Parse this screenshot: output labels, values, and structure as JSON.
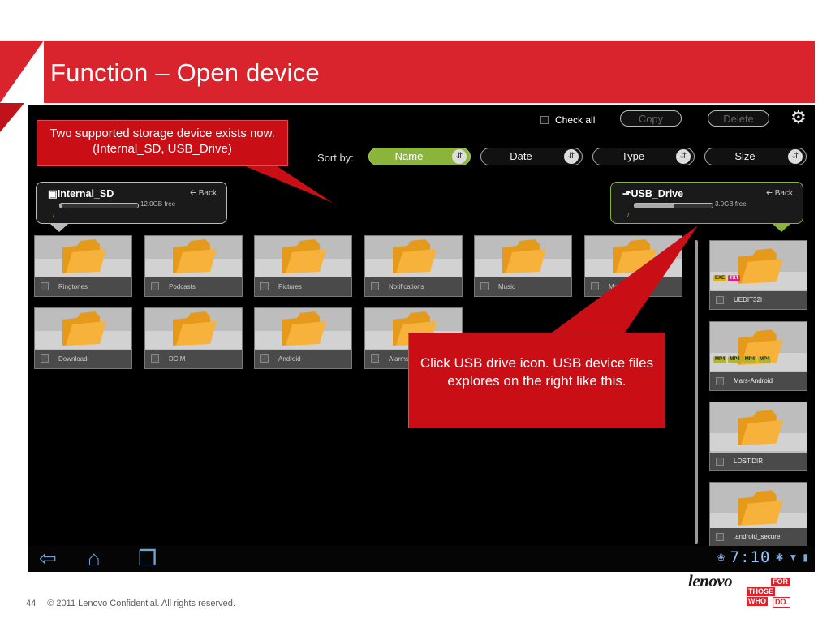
{
  "slide": {
    "title": "Function – Open device",
    "page_number": "44",
    "copyright": "© 2011 Lenovo Confidential. All rights reserved.",
    "logo_text": "lenovo",
    "tagline": [
      "FOR",
      "THOSE",
      "WHO",
      "DO."
    ]
  },
  "callouts": {
    "top_left": "Two supported storage device exists now.(Internal_SD, USB_Drive)",
    "center": "Click USB drive icon. USB device files explores on the right like this."
  },
  "toolbar": {
    "check_all": "Check all",
    "copy": "Copy",
    "delete": "Delete",
    "settings_icon": "gear-icon"
  },
  "sort": {
    "label": "Sort by:",
    "options": [
      {
        "label": "Name",
        "active": true
      },
      {
        "label": "Date",
        "active": false
      },
      {
        "label": "Type",
        "active": false
      },
      {
        "label": "Size",
        "active": false
      }
    ]
  },
  "devices": {
    "internal": {
      "name": "Internal_SD",
      "back": "Back",
      "free": "12.0GB free",
      "used_fraction": 0.02,
      "icon": "sd-card-icon"
    },
    "usb": {
      "name": "USB_Drive",
      "back": "Back",
      "free": "3.0GB free",
      "used_fraction": 0.5,
      "icon": "usb-icon"
    }
  },
  "folders_row1": [
    "Ringtones",
    "Podcasts",
    "Pictures",
    "Notifications",
    "Music",
    "Mo"
  ],
  "folders_row2": [
    "Download",
    "DCIM",
    "Android",
    "Alarms"
  ],
  "usb_files": [
    {
      "name": "UEDIT32I",
      "badges": [
        [
          "EXE",
          "#d8b41a"
        ],
        [
          "TXT",
          "#d6287a"
        ]
      ]
    },
    {
      "name": "Mars-Android",
      "badges": [
        [
          "MP4",
          "#b5b52a"
        ],
        [
          "MP4",
          "#b5b52a"
        ],
        [
          "MP4",
          "#b5b52a"
        ],
        [
          "MP4",
          "#b5b52a"
        ]
      ]
    },
    {
      "name": "LOST.DIR",
      "badges": []
    },
    {
      "name": ".android_secure",
      "badges": []
    }
  ],
  "status": {
    "clock": "7:10",
    "icons": [
      "android-debug-icon",
      "bluetooth-icon",
      "wifi-icon",
      "battery-icon"
    ]
  },
  "nav": [
    "back-icon",
    "home-icon",
    "recent-apps-icon"
  ],
  "colors": {
    "banner": "#d9232d",
    "callout": "#c90f15",
    "accent_green": "#8ab53a",
    "folder": "#f5a623"
  }
}
